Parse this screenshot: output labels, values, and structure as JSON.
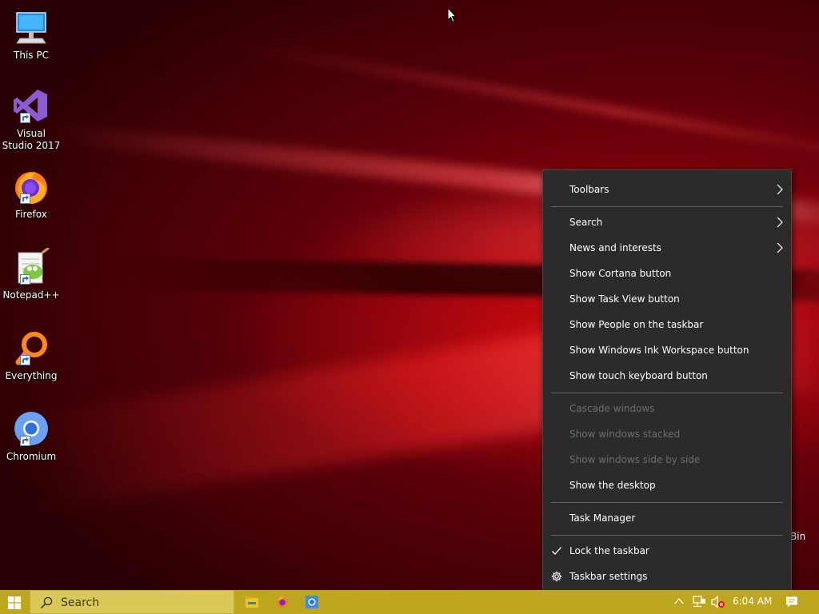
{
  "desktop": {
    "icons": [
      {
        "label": "This PC",
        "icon": "this-pc-icon",
        "shortcut": false
      },
      {
        "label": "Visual Studio 2017",
        "icon": "visual-studio-icon",
        "shortcut": true
      },
      {
        "label": "Firefox",
        "icon": "firefox-icon",
        "shortcut": true
      },
      {
        "label": "Notepad++",
        "icon": "notepad-plus-plus-icon",
        "shortcut": true
      },
      {
        "label": "Everything",
        "icon": "everything-search-icon",
        "shortcut": true
      },
      {
        "label": "Chromium",
        "icon": "chromium-icon",
        "shortcut": true
      }
    ],
    "recycle_bin_partial_label": "Bin"
  },
  "context_menu": {
    "items": [
      {
        "label": "Toolbars",
        "submenu": true,
        "enabled": true
      },
      {
        "label": "Search",
        "submenu": true,
        "enabled": true
      },
      {
        "label": "News and interests",
        "submenu": true,
        "enabled": true
      },
      {
        "label": "Show Cortana button",
        "enabled": true
      },
      {
        "label": "Show Task View button",
        "enabled": true
      },
      {
        "label": "Show People on the taskbar",
        "enabled": true
      },
      {
        "label": "Show Windows Ink Workspace button",
        "enabled": true
      },
      {
        "label": "Show touch keyboard button",
        "enabled": true
      },
      {
        "label": "Cascade windows",
        "enabled": false
      },
      {
        "label": "Show windows stacked",
        "enabled": false
      },
      {
        "label": "Show windows side by side",
        "enabled": false
      },
      {
        "label": "Show the desktop",
        "enabled": true
      },
      {
        "label": "Task Manager",
        "enabled": true
      },
      {
        "label": "Lock the taskbar",
        "checked": true,
        "enabled": true
      },
      {
        "label": "Taskbar settings",
        "icon": "gear-icon",
        "enabled": true
      }
    ]
  },
  "taskbar": {
    "search_placeholder": "Search",
    "pinned_apps": [
      "file-explorer-icon",
      "firefox-icon",
      "chromium-icon"
    ],
    "tray_icons": [
      "chevron-up-icon",
      "network-icon",
      "volume-muted-icon"
    ],
    "clock": "6:04 AM"
  },
  "colors": {
    "taskbar": "#bda71f",
    "menu_background": "#2b2b2b",
    "menu_disabled_text": "#6d6d6d",
    "wallpaper_accent": "#c8000f"
  }
}
